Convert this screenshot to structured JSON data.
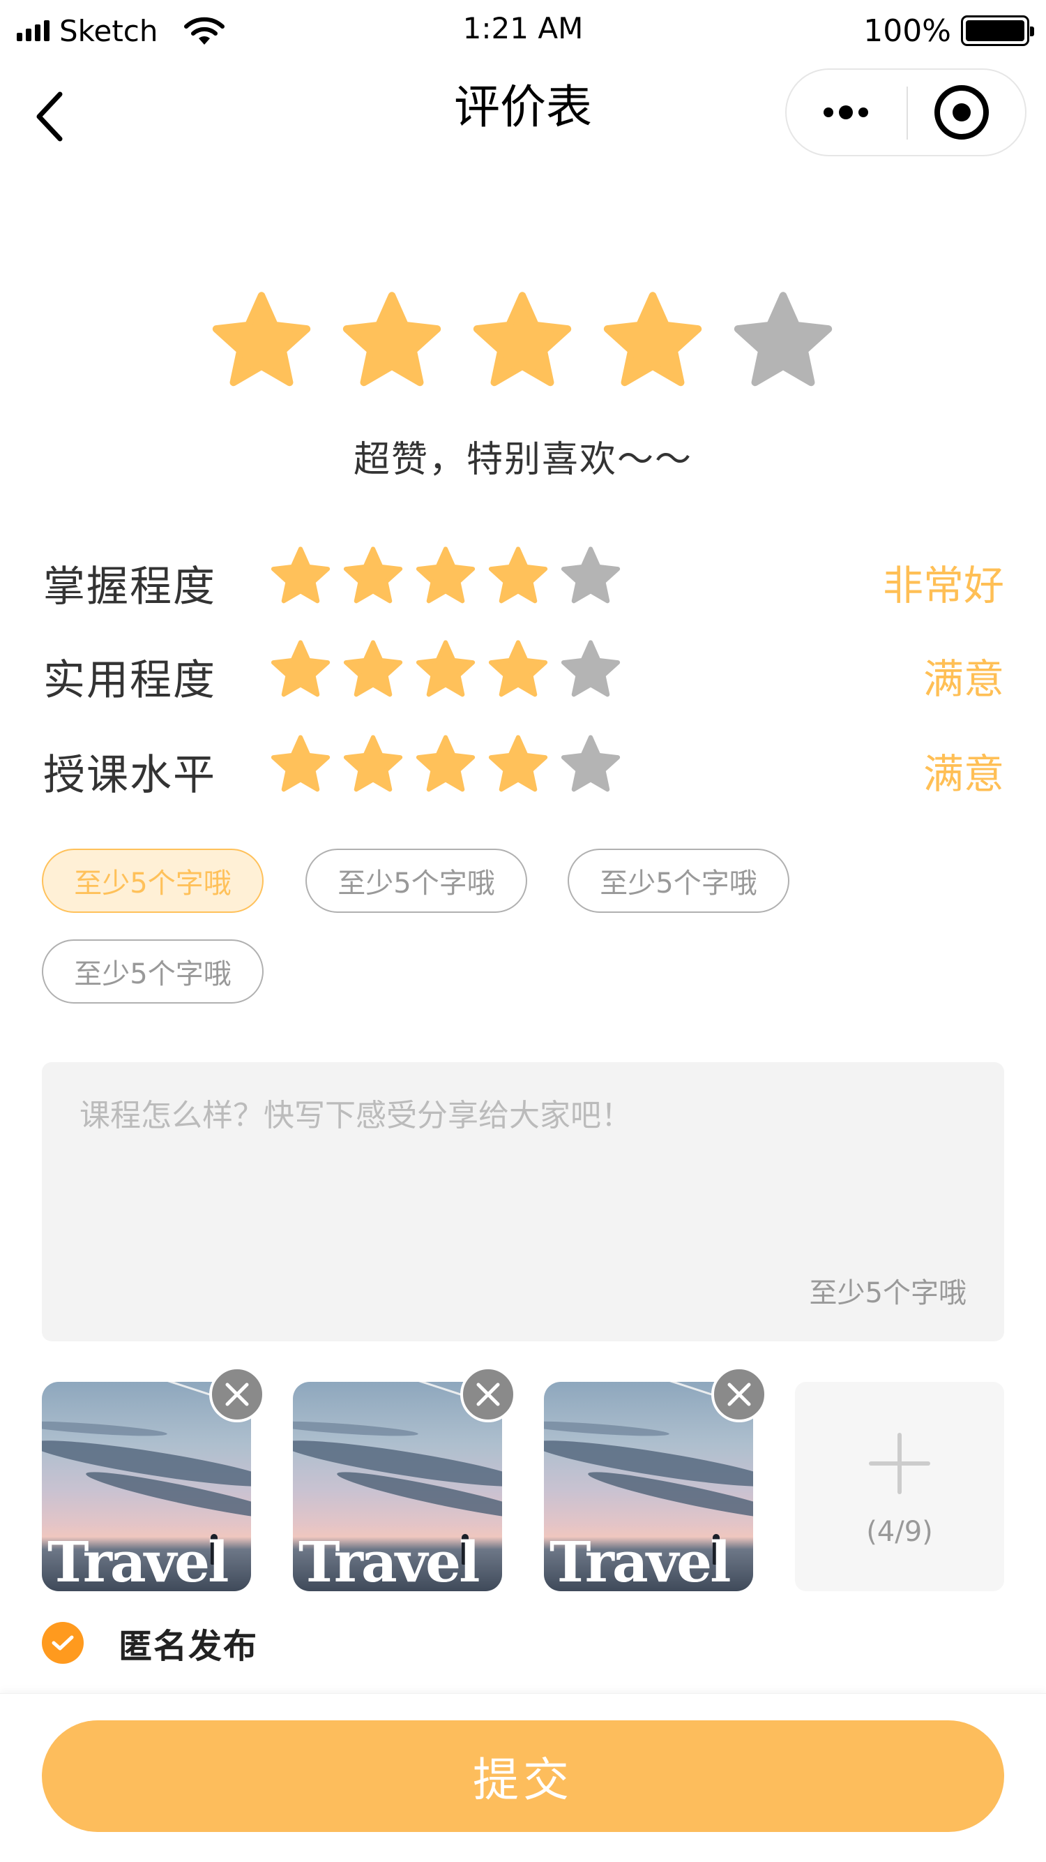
{
  "status_bar": {
    "carrier": "Sketch",
    "time": "1:21 AM",
    "battery": "100%"
  },
  "nav": {
    "title": "评价表"
  },
  "overall_rating": {
    "stars": 4,
    "max": 5,
    "text": "超赞，特别喜欢～～"
  },
  "sub_ratings": [
    {
      "label": "掌握程度",
      "stars": 4,
      "max": 5,
      "value": "非常好"
    },
    {
      "label": "实用程度",
      "stars": 4,
      "max": 5,
      "value": "满意"
    },
    {
      "label": "授课水平",
      "stars": 4,
      "max": 5,
      "value": "满意"
    }
  ],
  "tags": [
    {
      "label": "至少5个字哦",
      "selected": true
    },
    {
      "label": "至少5个字哦",
      "selected": false
    },
    {
      "label": "至少5个字哦",
      "selected": false
    },
    {
      "label": "至少5个字哦",
      "selected": false
    }
  ],
  "comment": {
    "placeholder": "课程怎么样？快写下感受分享给大家吧！",
    "value": "",
    "hint": "至少5个字哦"
  },
  "photos": {
    "items": [
      {
        "caption": "Travel"
      },
      {
        "caption": "Travel"
      },
      {
        "caption": "Travel"
      }
    ],
    "count_label": "(4/9)"
  },
  "anonymous": {
    "label": "匿名发布",
    "checked": true
  },
  "submit": {
    "label": "提交"
  },
  "colors": {
    "star_active": "#ffc15a",
    "star_inactive": "#b4b4b4",
    "accent": "#ffbf55",
    "checkbox": "#ff9a1e",
    "submit_bg": "#fdbd5c"
  }
}
